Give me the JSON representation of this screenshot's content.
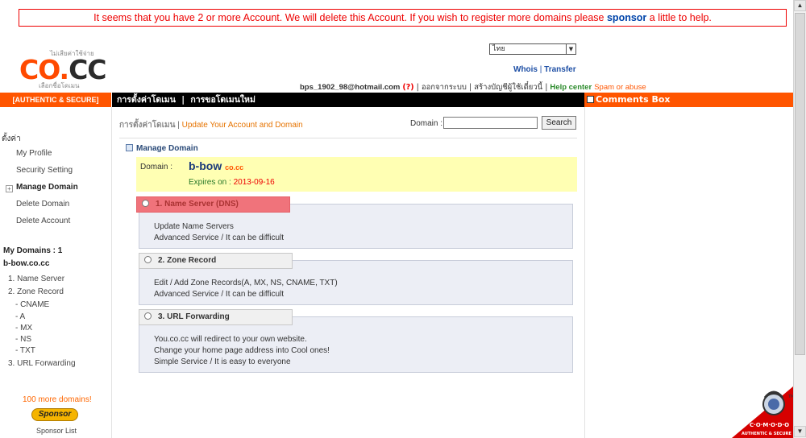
{
  "warning": {
    "text_before": "It seems that you have 2 or more Account. We will delete this Account. If you wish to register more domains please ",
    "highlight": "sponsor",
    "text_after": " a little to help."
  },
  "logo": {
    "top_text": "ไม่เสียค่าใช้จ่าย",
    "co": "CO.",
    "cc": "CC",
    "bottom_text": "เลือกชื่อโดเมน"
  },
  "language": {
    "selected": "ไทย"
  },
  "top_links": {
    "whois": "Whois",
    "separator": "|",
    "transfer": "Transfer"
  },
  "user_line": {
    "email": "bps_1902_98@hotmail.com",
    "question": "(?)",
    "sep": "|",
    "logout": "ออกจากระบบ",
    "new_account": "สร้างบัญชีผู้ใช้เดี๋ยวนี้",
    "help": "Help center",
    "spam": "Spam or abuse"
  },
  "nav": {
    "left_label": "[AUTHENTIC & SECURE]",
    "item1": "การตั้งค่าโดเมน",
    "separator": "|",
    "item2": "การขอโดเมนใหม่",
    "comments": "Comments Box"
  },
  "sidebar": {
    "header": "ตั้งค่า",
    "items": [
      "My Profile",
      "Security Setting",
      "Manage Domain",
      "Delete Domain",
      "Delete Account"
    ],
    "plus": "+",
    "my_domains": "My Domains : 1",
    "domain": "b-bow.co.cc",
    "tree": {
      "name_server": "1. Name Server",
      "zone_record": "2. Zone Record",
      "cname": "- CNAME",
      "a": "- A",
      "mx": "- MX",
      "ns": "- NS",
      "txt": "- TXT",
      "url_forwarding": "3. URL Forwarding"
    },
    "more_domains": "100 more domains!",
    "sponsor_button": "Sponsor",
    "sponsor_list": "Sponsor List"
  },
  "breadcrumb": {
    "root": "การตั้งค่าโดเมน",
    "sep": "|",
    "current": "Update Your Account and Domain"
  },
  "search": {
    "label": "Domain :",
    "value": "",
    "button": "Search"
  },
  "manage_domain": {
    "title": "Manage Domain",
    "domain_label": "Domain :",
    "domain_name": "b-bow",
    "domain_tld": "co.cc",
    "expires_label": "Expires on : ",
    "expires_date": "2013-09-16"
  },
  "services": [
    {
      "title": "1. Name Server (DNS)",
      "lines": [
        "Update Name Servers",
        "Advanced Service / It can be difficult"
      ],
      "selected": true
    },
    {
      "title": "2. Zone Record",
      "lines": [
        "Edit / Add Zone Records(A, MX, NS, CNAME, TXT)",
        "Advanced Service / It can be difficult"
      ],
      "selected": false
    },
    {
      "title": "3. URL Forwarding",
      "lines": [
        "You.co.cc will redirect to your own website.",
        "Change your home page address into Cool ones!",
        "Simple Service / It is easy to everyone"
      ],
      "selected": false
    }
  ],
  "comodo": {
    "brand": "C·O·M·O·D·O",
    "tagline": "AUTHENTIC & SECURE",
    "tm": "TM"
  },
  "colors": {
    "brand_orange": "#ff5500",
    "warning_red": "#ee0000",
    "selected_service": "#f0737b",
    "domain_box": "#ffffb3"
  }
}
